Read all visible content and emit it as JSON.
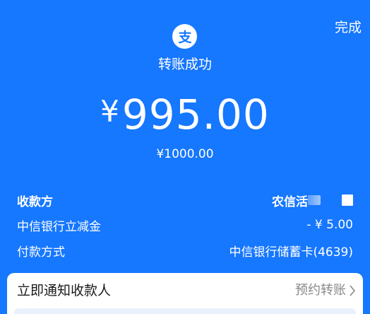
{
  "header": {
    "done_label": "完成",
    "logo_icon": "alipay-logo-icon",
    "title": "转账成功"
  },
  "amount": {
    "currency": "¥",
    "value": "995.00",
    "original": "¥1000.00"
  },
  "details": {
    "payee_label": "收款方",
    "payee_value": "农信活",
    "discount_label": "中信银行立减金",
    "discount_value": "- ¥ 5.00",
    "method_label": "付款方式",
    "method_value": "中信银行储蓄卡(4639)"
  },
  "actions": {
    "notify_label": "立即通知收款人",
    "schedule_label": "预约转账",
    "schedule_icon": "chevron-right-icon"
  },
  "colors": {
    "background": "#1677ff",
    "card": "#ffffff"
  }
}
